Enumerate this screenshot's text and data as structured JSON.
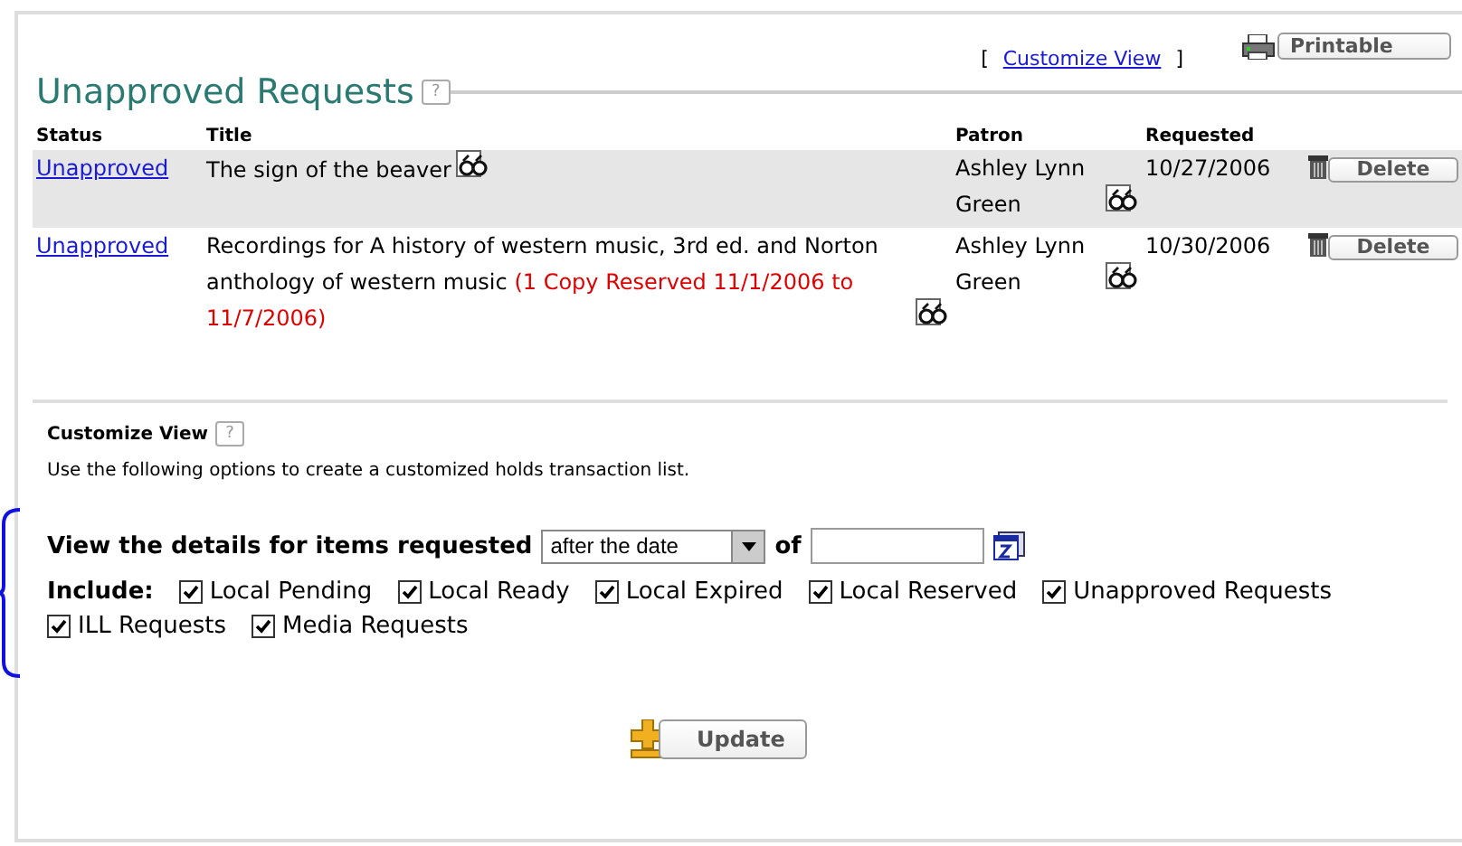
{
  "header": {
    "bracket_open": "[",
    "customize_link": "Customize View",
    "bracket_close": "]",
    "printable_button": "Printable"
  },
  "section": {
    "title": "Unapproved Requests",
    "help": "?"
  },
  "table": {
    "columns": [
      "Status",
      "Title",
      "Patron",
      "Requested"
    ],
    "rows": [
      {
        "status": "Unapproved",
        "title": "The sign of the beaver",
        "patron": "Ashley Lynn Green",
        "requested": "10/27/2006",
        "action": "Delete",
        "selected": true
      },
      {
        "status": "Unapproved",
        "title": "Recordings for A history of western music, 3rd ed. and Norton anthology of western music",
        "note": "(1 Copy Reserved 11/1/2006 to 11/7/2006)",
        "patron": "Ashley Lynn Green",
        "requested": "10/30/2006",
        "action": "Delete",
        "selected": false
      }
    ]
  },
  "customize": {
    "title": "Customize View",
    "help": "?",
    "description": "Use the following options to create a customized holds transaction list.",
    "details_label": "View the details for items requested",
    "date_select": "after the date",
    "of_label": "of",
    "include_label": "Include:",
    "options": [
      {
        "label": "Local Pending",
        "checked": true
      },
      {
        "label": "Local Ready",
        "checked": true
      },
      {
        "label": "Local Expired",
        "checked": true
      },
      {
        "label": "Local Reserved",
        "checked": true
      },
      {
        "label": "Unapproved Requests",
        "checked": true
      },
      {
        "label": "ILL Requests",
        "checked": true
      },
      {
        "label": "Media Requests",
        "checked": true
      }
    ],
    "update_button": "Update"
  }
}
